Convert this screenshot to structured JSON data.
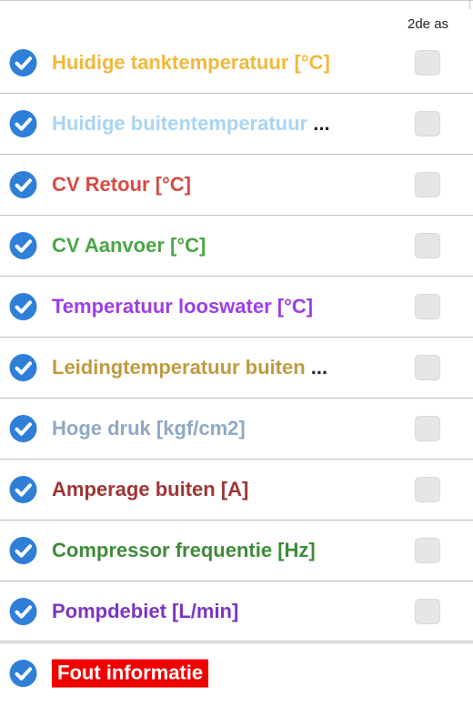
{
  "header": {
    "secondary_axis_label": "2de as"
  },
  "series": [
    {
      "label": "Huidige tanktemperatuur [°C]",
      "color": "#f0b93c",
      "selected": true,
      "secondary_axis": false
    },
    {
      "label": "Huidige buitentemperatuur",
      "truncated": true,
      "color": "#a9d4f5",
      "selected": true,
      "secondary_axis": false
    },
    {
      "label": "CV Retour [°C]",
      "color": "#d64a43",
      "selected": true,
      "secondary_axis": false
    },
    {
      "label": "CV Aanvoer [°C]",
      "color": "#4aa646",
      "selected": true,
      "secondary_axis": false
    },
    {
      "label": "Temperatuur looswater [°C]",
      "color": "#9b3ee6",
      "selected": true,
      "secondary_axis": false
    },
    {
      "label": "Leidingtemperatuur buiten",
      "truncated": true,
      "color": "#bd9b3f",
      "selected": true,
      "secondary_axis": false
    },
    {
      "label": "Hoge druk [kgf/cm2]",
      "color": "#8fa9c4",
      "selected": true,
      "secondary_axis": false
    },
    {
      "label": "Amperage buiten [A]",
      "color": "#9e3535",
      "selected": true,
      "secondary_axis": false
    },
    {
      "label": "Compressor frequentie [Hz]",
      "color": "#3f8a3a",
      "selected": true,
      "secondary_axis": false
    },
    {
      "label": "Pompdebiet [L/min]",
      "color": "#7b35c0",
      "selected": true,
      "secondary_axis": false
    }
  ],
  "error_item": {
    "label": "Fout informatie",
    "color": "#f10000",
    "selected": true
  },
  "icons": {
    "row_check": "check-circle-icon",
    "check_color": "#2f7fd8"
  },
  "ellipsis": "..."
}
